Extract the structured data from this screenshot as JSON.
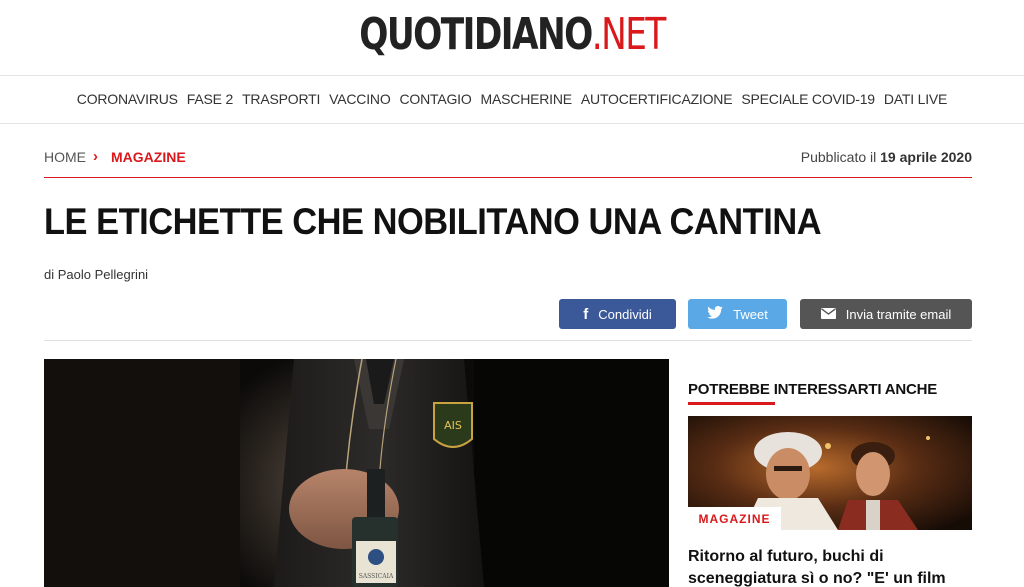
{
  "header": {
    "logo_main": "QUOTIDIANO",
    "logo_suffix": ".NET"
  },
  "nav": {
    "items": [
      "CORONAVIRUS",
      "FASE 2",
      "TRASPORTI",
      "VACCINO",
      "CONTAGIO",
      "MASCHERINE",
      "AUTOCERTIFICAZIONE",
      "SPECIALE COVID-19",
      "DATI LIVE"
    ]
  },
  "breadcrumb": {
    "home": "HOME",
    "separator": "›",
    "section": "MAGAZINE",
    "published_prefix": "Pubblicato il",
    "published_date": "19 aprile 2020"
  },
  "article": {
    "title": "LE ETICHETTE CHE NOBILITANO UNA CANTINA",
    "author": "di Paolo Pellegrini"
  },
  "share": {
    "facebook_label": "Condividi",
    "twitter_label": "Tweet",
    "email_label": "Invia tramite email"
  },
  "sidebar": {
    "title": "POTREBBE INTERESSARTI ANCHE",
    "card": {
      "badge": "MAGAZINE",
      "title": "Ritorno al futuro, buchi di sceneggiatura sì o no? \"E' un film"
    }
  },
  "colors": {
    "brand_red": "#d9191c",
    "facebook": "#3b5998",
    "twitter": "#5aa9e6",
    "email": "#555555"
  }
}
